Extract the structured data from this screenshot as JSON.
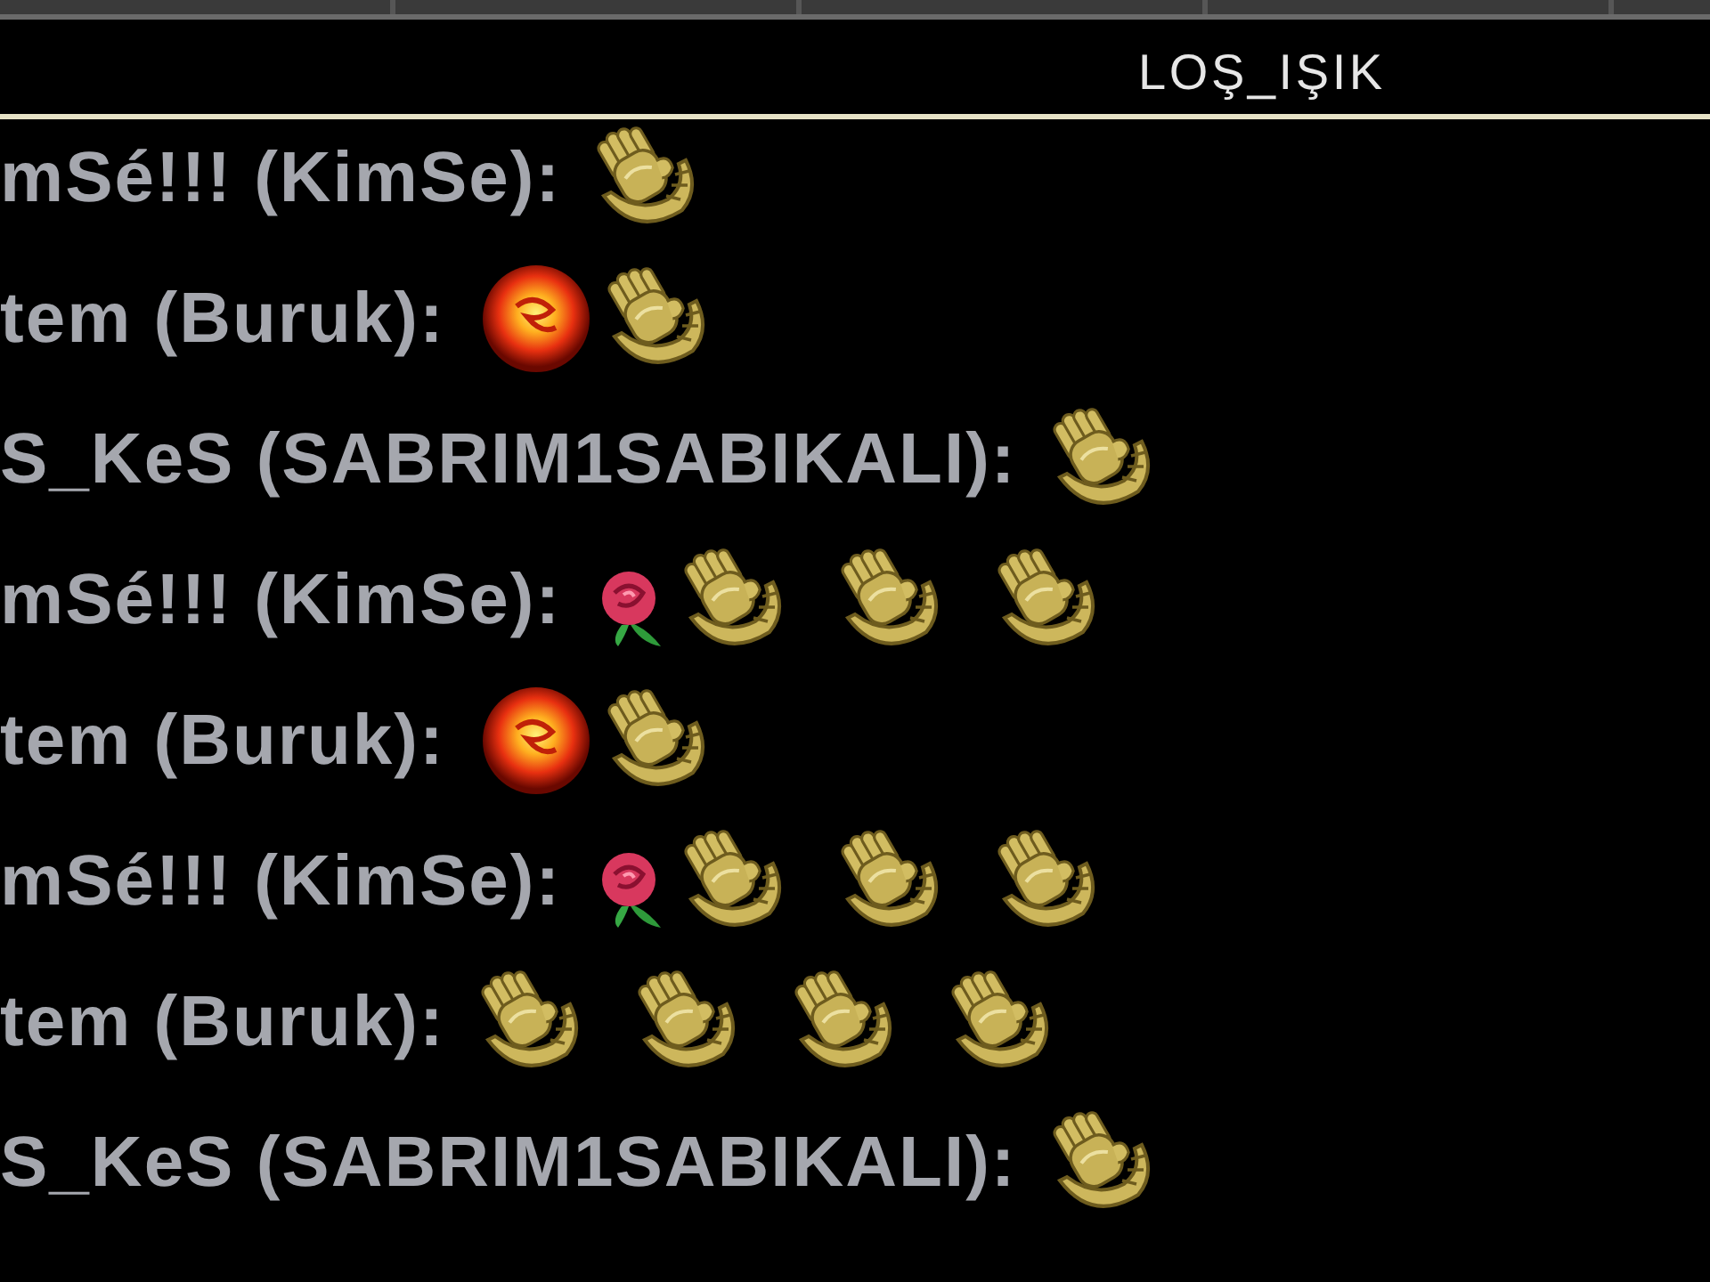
{
  "channel": {
    "title": "LOŞ_IŞIK"
  },
  "messages": [
    {
      "sender": "mSé!!! (KimSe):",
      "emoticons": [
        {
          "kind": "clap"
        }
      ]
    },
    {
      "sender": "tem (Buruk):",
      "emoticons": [
        {
          "kind": "fireball"
        },
        {
          "kind": "clap"
        }
      ]
    },
    {
      "sender": "S_KeS (SABRIM1SABIKALI):",
      "emoticons": [
        {
          "kind": "clap"
        }
      ]
    },
    {
      "sender": "mSé!!! (KimSe):",
      "emoticons": [
        {
          "kind": "rose"
        },
        {
          "kind": "clap"
        },
        {
          "kind": "clap"
        },
        {
          "kind": "clap"
        }
      ]
    },
    {
      "sender": "tem (Buruk):",
      "emoticons": [
        {
          "kind": "fireball"
        },
        {
          "kind": "clap"
        }
      ]
    },
    {
      "sender": "mSé!!! (KimSe):",
      "emoticons": [
        {
          "kind": "rose"
        },
        {
          "kind": "clap"
        },
        {
          "kind": "clap"
        },
        {
          "kind": "clap"
        }
      ]
    },
    {
      "sender": "tem (Buruk):",
      "emoticons": [
        {
          "kind": "clap"
        },
        {
          "kind": "clap"
        },
        {
          "kind": "clap"
        },
        {
          "kind": "clap"
        }
      ]
    },
    {
      "sender": "S_KeS (SABRIM1SABIKALI):",
      "emoticons": [
        {
          "kind": "clap"
        }
      ]
    }
  ]
}
